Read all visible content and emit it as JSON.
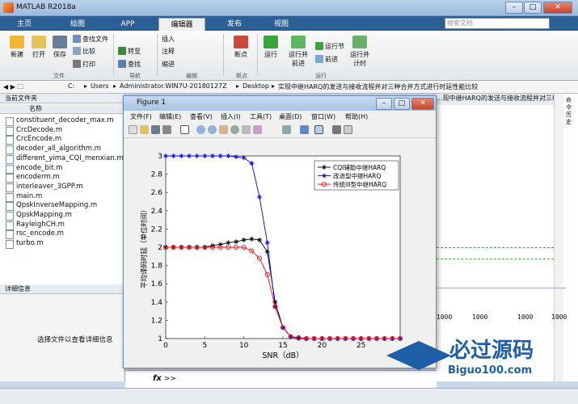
{
  "app": {
    "title": "MATLAB R2018a"
  },
  "tabs": [
    "主页",
    "绘图",
    "APP",
    "编辑器",
    "发布",
    "视图"
  ],
  "search_placeholder": "搜索文档",
  "ribbon": {
    "buttons": [
      "新建",
      "打开",
      "保存",
      "插入",
      "断点",
      "运行",
      "运行并\n前进",
      "前进",
      "运行并\n计时"
    ],
    "small": [
      "查找文件",
      "比较",
      "打印",
      "转至",
      "查找",
      "注释",
      "缩进",
      "运行节"
    ],
    "groups": [
      "文件",
      "导航",
      "编辑",
      "断点",
      "运行"
    ]
  },
  "address": [
    "C:",
    "Users",
    "Administrator.WIN7U-20180127Z",
    "Desktop",
    "实现中继HARQ的发送与接收流程并对三种合并方式进行时延性能比较"
  ],
  "current_folder": {
    "title": "当前文件夹",
    "column": "名称",
    "files": [
      "constituent_decoder_max.m",
      "CrcDecode.m",
      "CrcEncode.m",
      "decoder_all_algorithm.m",
      "different_yima_CQI_menxian.m",
      "encode_bit.m",
      "encoderm.m",
      "interleaver_3GPP.m",
      "main.m",
      "QpskInverseMapping.m",
      "QpskMapping.m",
      "RayleighCH.m",
      "rsc_encode.m",
      "turbo.m"
    ]
  },
  "details": {
    "title": "详细信息",
    "message": "选择文件以查看详细信息"
  },
  "right_pane": {
    "header": "...现中继HARQ的发送与接收流程并对三种合并方式进行时...",
    "values": [
      "1000",
      "1000",
      "1000",
      "1000"
    ]
  },
  "command": {
    "fx": "fx",
    "prompt": ">>"
  },
  "figure": {
    "title": "Figure 1",
    "menu": [
      "文件(F)",
      "编辑(E)",
      "查看(V)",
      "插入(I)",
      "工具(T)",
      "桌面(D)",
      "窗口(W)",
      "帮助(H)"
    ]
  },
  "watermark": {
    "text": "必过源码",
    "url": "Biguo100.com"
  },
  "colors": {
    "tabbar": "#2b5f95",
    "series1": "#000000",
    "series2": "#0000ff",
    "series3": "#ff0000"
  },
  "chart_data": {
    "type": "line",
    "xlabel": "SNR（dB）",
    "ylabel": "平均译码时延（单位时间）",
    "xlim": [
      0,
      30
    ],
    "ylim": [
      1,
      3
    ],
    "xticks": [
      0,
      5,
      10,
      15,
      20,
      25
    ],
    "yticks": [
      1,
      1.2,
      1.4,
      1.6,
      1.8,
      2,
      2.2,
      2.4,
      2.6,
      2.8,
      3
    ],
    "legend_position": "top-right",
    "x": [
      0,
      1,
      2,
      3,
      4,
      5,
      6,
      7,
      8,
      9,
      10,
      11,
      12,
      13,
      14,
      15,
      16,
      17,
      18,
      19,
      20,
      21,
      22,
      23,
      24,
      25,
      26,
      27,
      28,
      29,
      30
    ],
    "series": [
      {
        "name": "CQI辅助中继HARQ",
        "marker": "star",
        "color": "#000000",
        "values": [
          2,
          2,
          2,
          2,
          2,
          2,
          2.02,
          2.03,
          2.05,
          2.06,
          2.08,
          2.09,
          2.08,
          1.95,
          1.4,
          1.12,
          1.02,
          1.01,
          1,
          1,
          1,
          1,
          1,
          1,
          1,
          1,
          1,
          1,
          1,
          1,
          1
        ]
      },
      {
        "name": "改进型中继HARQ",
        "marker": "star",
        "color": "#0000ff",
        "values": [
          3,
          3,
          3,
          3,
          3,
          3,
          3,
          3,
          3,
          2.99,
          2.98,
          2.92,
          2.55,
          2.05,
          1.35,
          1.12,
          1.02,
          1,
          1,
          1,
          1,
          1,
          1,
          1,
          1,
          1,
          1,
          1,
          1,
          1,
          1
        ]
      },
      {
        "name": "传统III型中继HARQ",
        "marker": "circle",
        "color": "#ff0000",
        "values": [
          2,
          2,
          2,
          2,
          2,
          2,
          2,
          2,
          2,
          2,
          2,
          1.96,
          1.88,
          1.7,
          1.35,
          1.12,
          1.02,
          1.01,
          1,
          1,
          1,
          1,
          1,
          1,
          1,
          1,
          1,
          1,
          1,
          1,
          1
        ]
      }
    ]
  }
}
